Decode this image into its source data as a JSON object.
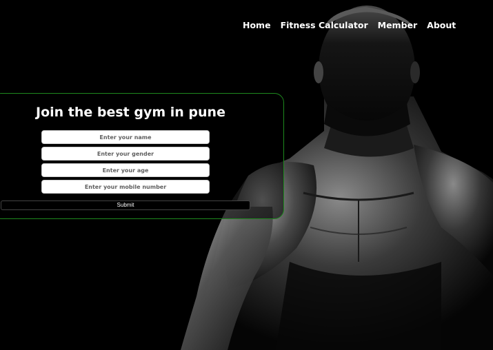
{
  "nav": {
    "items": [
      {
        "label": "Home"
      },
      {
        "label": "Fitness Calculator"
      },
      {
        "label": "Member"
      },
      {
        "label": "About"
      }
    ]
  },
  "form": {
    "title": "Join the best gym in pune",
    "fields": {
      "name_placeholder": "Enter your name",
      "gender_placeholder": "Enter your gender",
      "age_placeholder": "Enter your age",
      "mobile_placeholder": "Enter your mobile number"
    },
    "submit_label": "Submit"
  },
  "colors": {
    "background": "#000000",
    "card_border": "#1e8a1e",
    "text": "#ffffff"
  }
}
